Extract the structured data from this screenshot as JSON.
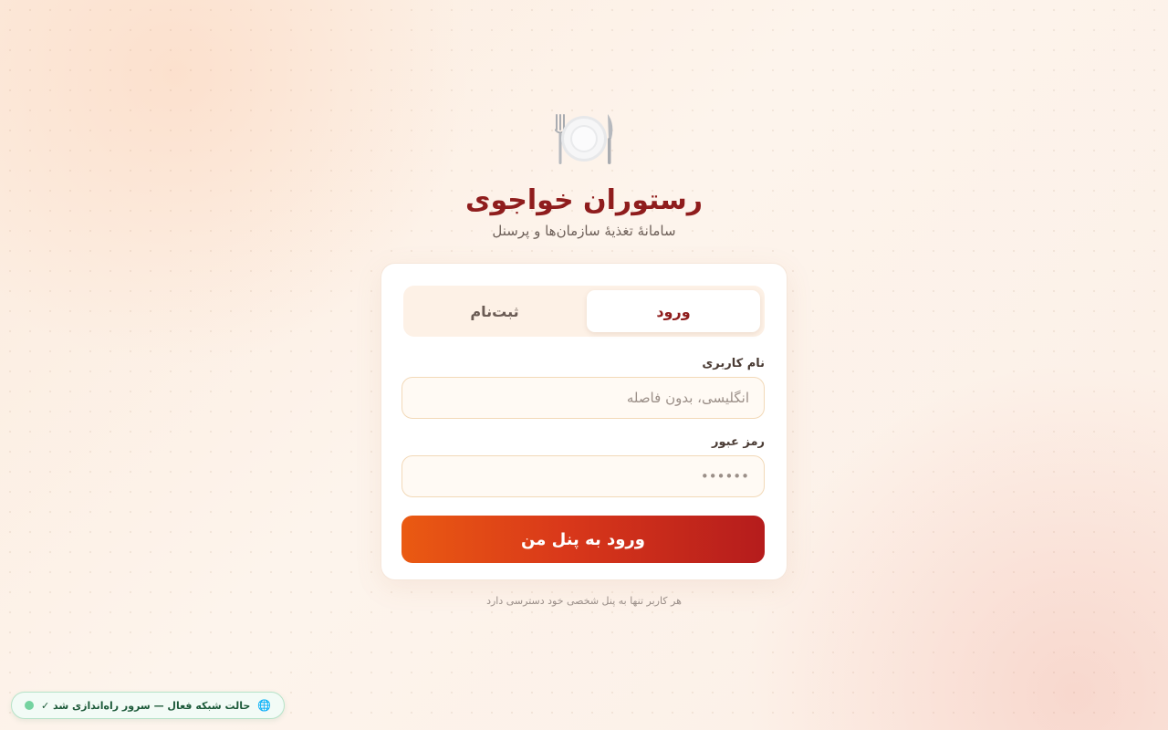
{
  "header": {
    "logo_icon": "plate-fork-knife-icon",
    "title": "رستوران خواجوی",
    "subtitle": "سامانهٔ تغذیهٔ سازمان‌ها و پرسنل"
  },
  "tabs": [
    {
      "label": "ورود",
      "active": true
    },
    {
      "label": "ثبت‌نام",
      "active": false
    }
  ],
  "form": {
    "username": {
      "label": "نام کاربری",
      "value": "",
      "placeholder": "انگلیسی، بدون فاصله"
    },
    "password": {
      "label": "رمز عبور",
      "value": "",
      "placeholder": "••••••"
    },
    "submit_label": "ورود به پنل من"
  },
  "footnote": "هر کاربر تنها به پنل شخصی خود دسترسی دارد",
  "status": {
    "icon": "globe-icon",
    "text": "حالت شبکه فعال — سرور راه‌اندازی شد ✓",
    "dot_color": "#74d3a0"
  },
  "colors": {
    "brand": "#8f1d1d",
    "button_start": "#ea5a12",
    "button_end": "#b51c1c"
  }
}
